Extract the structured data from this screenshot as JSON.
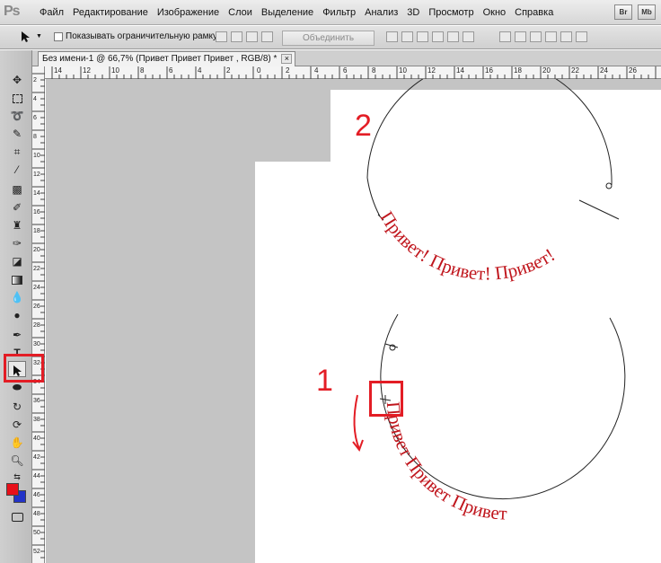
{
  "app": {
    "logo": "Ps"
  },
  "menu": [
    "Файл",
    "Редактирование",
    "Изображение",
    "Слои",
    "Выделение",
    "Фильтр",
    "Анализ",
    "3D",
    "Просмотр",
    "Окно",
    "Справка"
  ],
  "menu_right": [
    "Br",
    "Mb"
  ],
  "options_bar": {
    "show_bounding_box_label": "Показывать ограничительную рамку",
    "show_bounding_box_checked": false,
    "combine_label": "Объединить"
  },
  "document": {
    "tab_title": "Без имени-1 @ 66,7% (Привет Привет  Привет , RGB/8) *",
    "close_label": "×"
  },
  "ruler": {
    "top_labels": [
      "14",
      "12",
      "10",
      "8",
      "6",
      "4",
      "2",
      "0",
      "2",
      "4",
      "6",
      "8",
      "10",
      "12",
      "14",
      "16",
      "18",
      "20",
      "22",
      "24",
      "26"
    ],
    "left_labels": [
      "2",
      "4",
      "6",
      "8",
      "10",
      "12",
      "14",
      "16",
      "18",
      "20",
      "22",
      "24",
      "26",
      "28",
      "30",
      "32",
      "34",
      "36",
      "38",
      "40",
      "42",
      "44",
      "46",
      "48",
      "50",
      "52"
    ]
  },
  "canvas": {
    "text_top": "Привет! Привет! Привет!",
    "text_bottom": "Привет Привет Привет",
    "marker_top": "2",
    "marker_bottom": "1"
  },
  "colors": {
    "accent": "#e31d25",
    "foreground": "#e8101a",
    "background": "#2233c8",
    "canvas_bg": "#c4c4c4"
  },
  "icons": [
    "move-icon",
    "marquee-icon",
    "lasso-icon",
    "quick-selection-icon",
    "crop-icon",
    "eyedropper-icon",
    "healing-icon",
    "brush-icon",
    "stamp-icon",
    "history-brush-icon",
    "eraser-icon",
    "gradient-icon",
    "blur-icon",
    "dodge-icon",
    "pen-icon",
    "type-icon",
    "path-selection-icon",
    "shape-icon",
    "3d-rotate-icon",
    "3d-orbit-icon",
    "hand-icon",
    "zoom-icon",
    "swap-colors-icon",
    "quick-mask-icon"
  ]
}
